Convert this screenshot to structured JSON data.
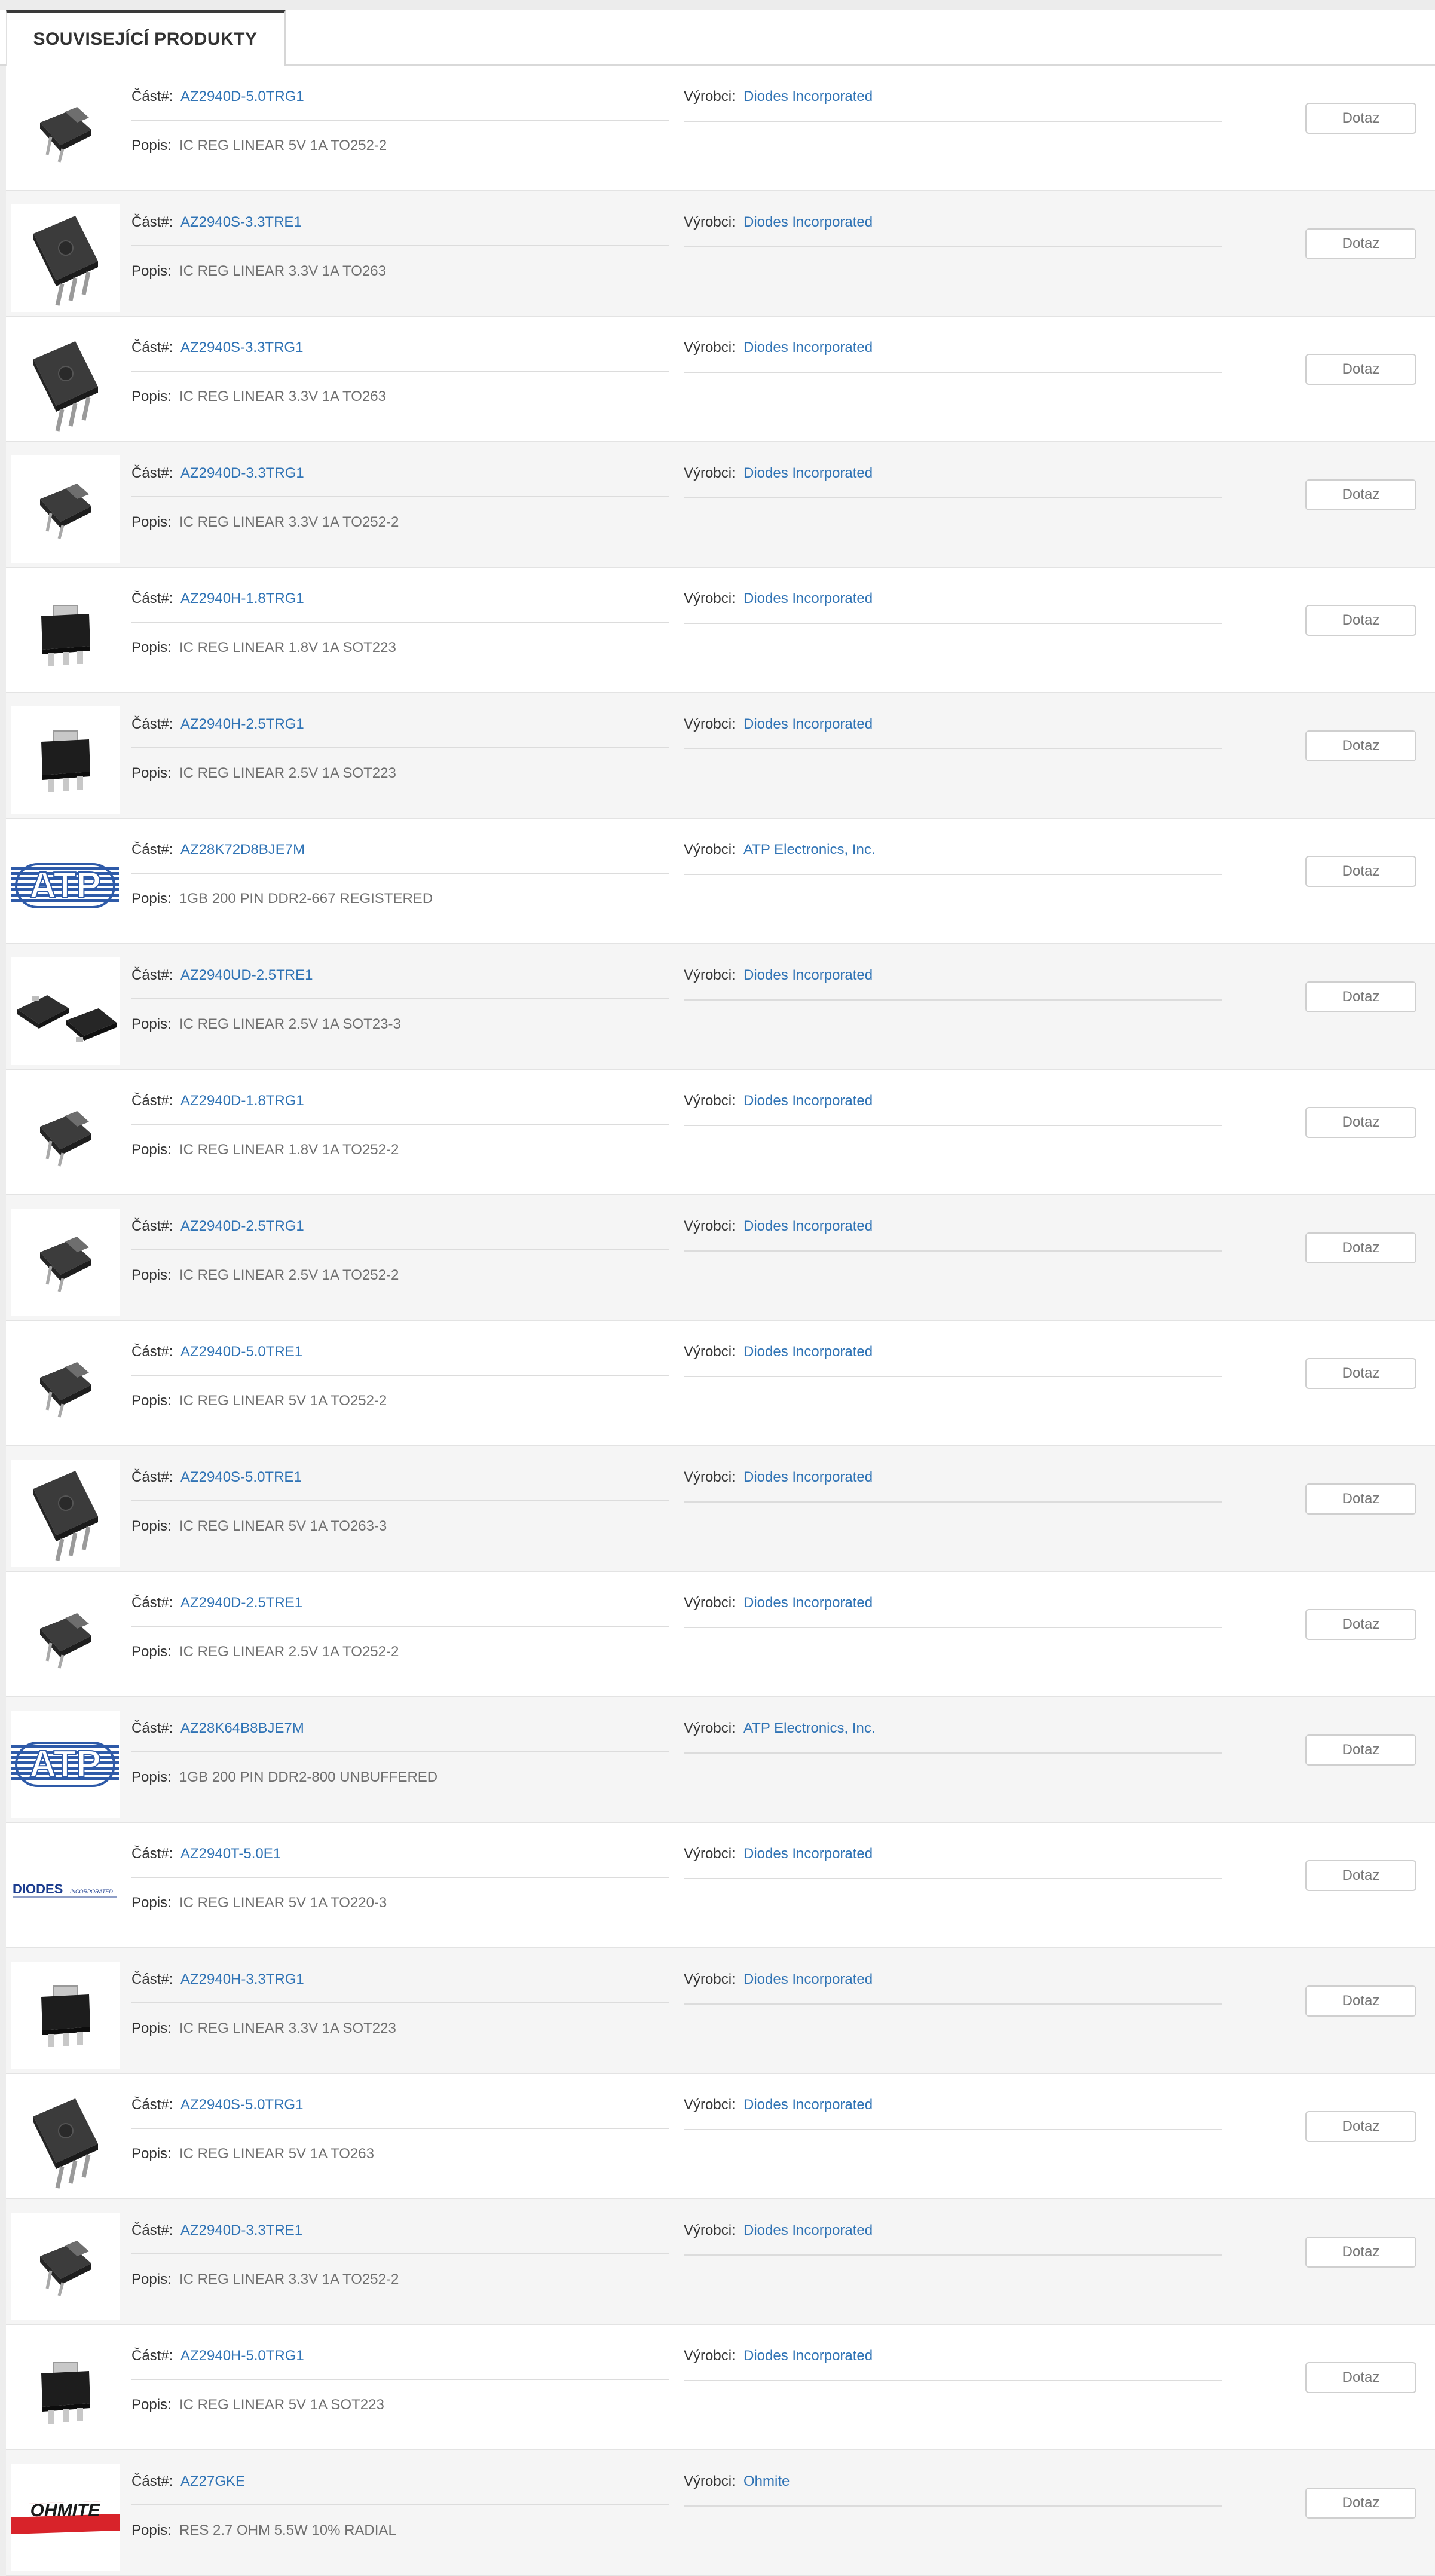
{
  "tab": {
    "label": "SOUVISEJÍCÍ PRODUKTY"
  },
  "labels": {
    "part": "Část#:",
    "manufacturer": "Výrobci:",
    "description": "Popis:",
    "button": "Dotaz"
  },
  "colors": {
    "link": "#2f73b5",
    "row_alt": "#f5f5f5",
    "row": "#ffffff",
    "tab_accent": "#3a3a3a"
  },
  "products": [
    {
      "part": "AZ2940D-5.0TRG1",
      "manufacturer": "Diodes Incorporated",
      "description": "IC REG LINEAR 5V 1A TO252-2",
      "image": "to252-icon"
    },
    {
      "part": "AZ2940S-3.3TRE1",
      "manufacturer": "Diodes Incorporated",
      "description": "IC REG LINEAR 3.3V 1A TO263",
      "image": "to263-icon"
    },
    {
      "part": "AZ2940S-3.3TRG1",
      "manufacturer": "Diodes Incorporated",
      "description": "IC REG LINEAR 3.3V 1A TO263",
      "image": "to263-icon"
    },
    {
      "part": "AZ2940D-3.3TRG1",
      "manufacturer": "Diodes Incorporated",
      "description": "IC REG LINEAR 3.3V 1A TO252-2",
      "image": "to252-icon"
    },
    {
      "part": "AZ2940H-1.8TRG1",
      "manufacturer": "Diodes Incorporated",
      "description": "IC REG LINEAR 1.8V 1A SOT223",
      "image": "sot223-icon"
    },
    {
      "part": "AZ2940H-2.5TRG1",
      "manufacturer": "Diodes Incorporated",
      "description": "IC REG LINEAR 2.5V 1A SOT223",
      "image": "sot223-icon"
    },
    {
      "part": "AZ28K72D8BJE7M",
      "manufacturer": "ATP Electronics, Inc.",
      "description": "1GB 200 PIN DDR2-667 REGISTERED",
      "image": "atp-logo-icon",
      "logo_text": "ATP"
    },
    {
      "part": "AZ2940UD-2.5TRE1",
      "manufacturer": "Diodes Incorporated",
      "description": "IC REG LINEAR 2.5V 1A SOT23-3",
      "image": "sot23-icon"
    },
    {
      "part": "AZ2940D-1.8TRG1",
      "manufacturer": "Diodes Incorporated",
      "description": "IC REG LINEAR 1.8V 1A TO252-2",
      "image": "to252-icon"
    },
    {
      "part": "AZ2940D-2.5TRG1",
      "manufacturer": "Diodes Incorporated",
      "description": "IC REG LINEAR 2.5V 1A TO252-2",
      "image": "to252-icon"
    },
    {
      "part": "AZ2940D-5.0TRE1",
      "manufacturer": "Diodes Incorporated",
      "description": "IC REG LINEAR 5V 1A TO252-2",
      "image": "to252-icon"
    },
    {
      "part": "AZ2940S-5.0TRE1",
      "manufacturer": "Diodes Incorporated",
      "description": "IC REG LINEAR 5V 1A TO263-3",
      "image": "to263-icon"
    },
    {
      "part": "AZ2940D-2.5TRE1",
      "manufacturer": "Diodes Incorporated",
      "description": "IC REG LINEAR 2.5V 1A TO252-2",
      "image": "to252-icon"
    },
    {
      "part": "AZ28K64B8BJE7M",
      "manufacturer": "ATP Electronics, Inc.",
      "description": "1GB 200 PIN DDR2-800 UNBUFFERED",
      "image": "atp-logo-icon",
      "logo_text": "ATP"
    },
    {
      "part": "AZ2940T-5.0E1",
      "manufacturer": "Diodes Incorporated",
      "description": "IC REG LINEAR 5V 1A TO220-3",
      "image": "diodes-logo-icon",
      "logo_text": "DIODES",
      "logo_tagline": "INCORPORATED"
    },
    {
      "part": "AZ2940H-3.3TRG1",
      "manufacturer": "Diodes Incorporated",
      "description": "IC REG LINEAR 3.3V 1A SOT223",
      "image": "sot223-icon"
    },
    {
      "part": "AZ2940S-5.0TRG1",
      "manufacturer": "Diodes Incorporated",
      "description": "IC REG LINEAR 5V 1A TO263",
      "image": "to263-icon"
    },
    {
      "part": "AZ2940D-3.3TRE1",
      "manufacturer": "Diodes Incorporated",
      "description": "IC REG LINEAR 3.3V 1A TO252-2",
      "image": "to252-icon"
    },
    {
      "part": "AZ2940H-5.0TRG1",
      "manufacturer": "Diodes Incorporated",
      "description": "IC REG LINEAR 5V 1A SOT223",
      "image": "sot223-icon"
    },
    {
      "part": "AZ27GKE",
      "manufacturer": "Ohmite",
      "description": "RES 2.7 OHM 5.5W 10% RADIAL",
      "image": "ohmite-logo-icon",
      "logo_text": "OHMITE"
    }
  ]
}
